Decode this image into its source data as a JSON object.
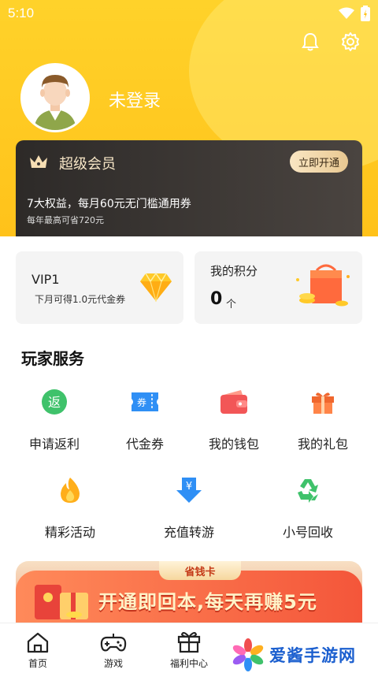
{
  "status_bar": {
    "time": "5:10"
  },
  "profile": {
    "login_label": "未登录"
  },
  "vip_banner": {
    "title": "超级会员",
    "open_button": "立即开通",
    "benefit_line": "7大权益，每月60元无门槛通用券",
    "saving_line": "每年最高可省720元"
  },
  "vip_card": {
    "level": "VIP1",
    "desc": "下月可得1.0元代金券"
  },
  "points_card": {
    "title": "我的积分",
    "value": "0",
    "unit": "个"
  },
  "services": {
    "title": "玩家服务",
    "items": [
      {
        "label": "申请返利",
        "badge": "返"
      },
      {
        "label": "代金券",
        "badge": "券"
      },
      {
        "label": "我的钱包"
      },
      {
        "label": "我的礼包"
      },
      {
        "label": "精彩活动"
      },
      {
        "label": "充值转游",
        "badge": "¥"
      },
      {
        "label": "小号回收"
      }
    ]
  },
  "promo": {
    "tag": "省钱卡",
    "text": "开通即回本,每天再赚5元"
  },
  "nav": {
    "items": [
      {
        "label": "首页"
      },
      {
        "label": "游戏"
      },
      {
        "label": "福利中心"
      }
    ]
  },
  "watermark": {
    "text": "爱酱手游网"
  },
  "colors": {
    "header_yellow": "#ffc21a",
    "vip_dark": "#3a3532",
    "accent_gold": "#e9c891"
  }
}
